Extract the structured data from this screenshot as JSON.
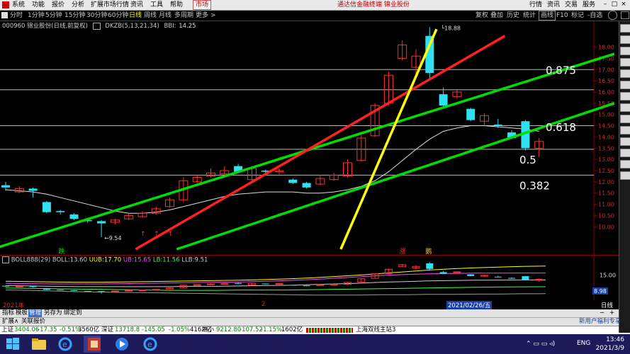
{
  "menu": {
    "items": [
      "系统",
      "功能",
      "报价",
      "分析",
      "扩展市场行情",
      "资讯",
      "工具",
      "帮助"
    ],
    "active": "市场",
    "center_title": "通达信金融终端  锦业股份",
    "right": [
      "行情",
      "资讯",
      "交易",
      "服务"
    ]
  },
  "periods": {
    "items": [
      "分时",
      "1分钟",
      "5分钟",
      "15分钟",
      "30分钟",
      "60分钟",
      "日线",
      "周线",
      "月线",
      "多周期",
      "更多 >"
    ],
    "selected_index": 6,
    "tools": [
      "复权",
      "叠加",
      "历史",
      "统计",
      "画线",
      "F10",
      "标记",
      "-自选"
    ]
  },
  "info": {
    "stock": "000960 锦业股份(日线,前复权)",
    "indicator": "DKZB(5,13,21,34)",
    "bbi_label": "BBI:",
    "bbi_value": "14.25"
  },
  "chart_data": {
    "type": "candlestick",
    "y_axis": {
      "min": 9,
      "max": 18.9,
      "ticks": [
        "18.00",
        "17.50",
        "17.00",
        "16.50",
        "16.00",
        "15.50",
        "15.00",
        "14.50",
        "14.00",
        "13.50",
        "13.00",
        "12.50",
        "12.00",
        "11.50",
        "11.00",
        "10.50",
        "10.00"
      ]
    },
    "candles": [
      {
        "o": 11.85,
        "c": 11.75,
        "h": 12.0,
        "l": 11.6
      },
      {
        "o": 11.55,
        "c": 11.7,
        "h": 11.8,
        "l": 11.5
      },
      {
        "o": 11.7,
        "c": 11.6,
        "h": 11.75,
        "l": 11.3
      },
      {
        "o": 11.1,
        "c": 10.65,
        "h": 11.15,
        "l": 10.6
      },
      {
        "o": 10.7,
        "c": 10.65,
        "h": 10.75,
        "l": 10.55
      },
      {
        "o": 10.55,
        "c": 10.35,
        "h": 10.6,
        "l": 10.3
      },
      {
        "o": 10.3,
        "c": 10.25,
        "h": 10.32,
        "l": 10.18
      },
      {
        "o": 10.25,
        "c": 10.15,
        "h": 10.3,
        "l": 9.54
      },
      {
        "o": 10.2,
        "c": 10.3,
        "h": 10.35,
        "l": 10.1
      },
      {
        "o": 10.35,
        "c": 10.5,
        "h": 10.6,
        "l": 10.3
      },
      {
        "o": 10.45,
        "c": 10.6,
        "h": 10.7,
        "l": 10.4
      },
      {
        "o": 10.6,
        "c": 10.8,
        "h": 10.9,
        "l": 10.55
      },
      {
        "o": 10.9,
        "c": 11.2,
        "h": 11.3,
        "l": 10.85
      },
      {
        "o": 11.2,
        "c": 12.05,
        "h": 12.2,
        "l": 11.1
      },
      {
        "o": 12.0,
        "c": 12.2,
        "h": 12.3,
        "l": 11.95
      },
      {
        "o": 12.25,
        "c": 12.4,
        "h": 12.6,
        "l": 12.2
      },
      {
        "o": 12.35,
        "c": 12.5,
        "h": 12.7,
        "l": 12.3
      },
      {
        "o": 12.7,
        "c": 12.45,
        "h": 12.8,
        "l": 12.4
      },
      {
        "o": 12.1,
        "c": 12.6,
        "h": 12.7,
        "l": 12.05
      },
      {
        "o": 12.5,
        "c": 12.45,
        "h": 12.55,
        "l": 12.35
      },
      {
        "o": 12.45,
        "c": 12.5,
        "h": 12.6,
        "l": 12.35
      },
      {
        "o": 12.1,
        "c": 11.95,
        "h": 12.15,
        "l": 11.9
      },
      {
        "o": 11.95,
        "c": 11.75,
        "h": 12.0,
        "l": 11.7
      },
      {
        "o": 11.9,
        "c": 12.15,
        "h": 12.3,
        "l": 11.85
      },
      {
        "o": 12.1,
        "c": 12.3,
        "h": 12.4,
        "l": 12.05
      },
      {
        "o": 12.25,
        "c": 12.85,
        "h": 13.0,
        "l": 12.2
      },
      {
        "o": 12.95,
        "c": 13.95,
        "h": 14.1,
        "l": 12.9
      },
      {
        "o": 14.05,
        "c": 15.4,
        "h": 15.5,
        "l": 14.0
      },
      {
        "o": 15.5,
        "c": 16.75,
        "h": 16.9,
        "l": 15.4
      },
      {
        "o": 17.5,
        "c": 18.1,
        "h": 18.3,
        "l": 17.4
      },
      {
        "o": 17.1,
        "c": 17.6,
        "h": 17.9,
        "l": 16.7
      },
      {
        "o": 18.5,
        "c": 16.85,
        "h": 18.88,
        "l": 16.6
      },
      {
        "o": 15.9,
        "c": 15.4,
        "h": 16.2,
        "l": 15.3
      },
      {
        "o": 15.8,
        "c": 16.0,
        "h": 16.1,
        "l": 15.7
      },
      {
        "o": 15.25,
        "c": 14.75,
        "h": 15.3,
        "l": 14.7
      },
      {
        "o": 14.7,
        "c": 14.95,
        "h": 15.05,
        "l": 14.5
      },
      {
        "o": 14.55,
        "c": 14.5,
        "h": 14.8,
        "l": 14.4
      },
      {
        "o": 14.2,
        "c": 13.95,
        "h": 14.3,
        "l": 13.9
      },
      {
        "o": 14.7,
        "c": 13.5,
        "h": 14.75,
        "l": 13.4
      },
      {
        "o": 13.5,
        "c": 13.8,
        "h": 13.95,
        "l": 13.1
      }
    ],
    "bbi_line": [
      11.65,
      11.6,
      11.55,
      11.45,
      11.3,
      11.15,
      11.0,
      10.85,
      10.7,
      10.6,
      10.6,
      10.65,
      10.75,
      10.9,
      11.05,
      11.2,
      11.35,
      11.45,
      11.5,
      11.55,
      11.55,
      11.55,
      11.5,
      11.5,
      11.55,
      11.65,
      11.8,
      12.05,
      12.45,
      12.95,
      13.45,
      13.9,
      14.25,
      14.4,
      14.5,
      14.5,
      14.45,
      14.4,
      14.35,
      14.25
    ],
    "h_levels": [
      17.0,
      16.1,
      14.5,
      13.45,
      12.3
    ],
    "level_labels": [
      {
        "text": "0.875",
        "level": 17.0
      },
      {
        "text": "0.618",
        "level": 14.45
      },
      {
        "text": "0.5",
        "level": 13.0
      },
      {
        "text": "0.382",
        "level": 11.85
      }
    ],
    "annotations": {
      "high": "18.88",
      "low": "9.54"
    },
    "markers": [
      "跌",
      "涨",
      "鹅"
    ],
    "trendlines": [
      {
        "color": "#00dd00",
        "from": [
          -1,
          9.0
        ],
        "to": [
          44.5,
          17.7
        ]
      },
      {
        "color": "#00dd00",
        "from": [
          12.5,
          9.0
        ],
        "to": [
          44.5,
          15.5
        ]
      },
      {
        "color": "#ff2020",
        "from": [
          9.5,
          9.0
        ],
        "to": [
          36.5,
          18.5
        ]
      },
      {
        "color": "#ffff00",
        "from": [
          24.5,
          9.0
        ],
        "to": [
          31.5,
          18.8
        ]
      }
    ]
  },
  "boll": {
    "title": "BOLL888(29)",
    "boll_label": "BOLL:",
    "boll_value": "13.60",
    "uub_label": "UUB:",
    "uub_value": "17.70",
    "ub_label": "UB:",
    "ub_value": "15.65",
    "lb_label": "LB:",
    "lb_value": "11.56",
    "llb_label": "LLB:",
    "llb_value": "9.51",
    "axis_tick": "15.00",
    "current_box": "8.98"
  },
  "xaxis": {
    "year": "2021年",
    "mid": "2",
    "date_box": "2021/02/26/五",
    "right_label": "日线"
  },
  "tabs": [
    "指标",
    "模板",
    "管理",
    "另存为",
    "绑定到"
  ],
  "tabs2": {
    "left": "扩展∧",
    "quote": "关联报价",
    "ad": "新用户福利专享"
  },
  "ticker": [
    {
      "label": "上证",
      "value": "3404.06",
      "change": "-17.35",
      "pct": "-0.51%",
      "vol": "3560亿"
    },
    {
      "label": "深证",
      "value": "13718.8",
      "change": "-145.05",
      "pct": "-1.05%",
      "vol": "4162亿"
    },
    {
      "label": "中小",
      "value": "9212.80",
      "change": "-107.52",
      "pct": "-1.15%",
      "vol": "1602亿"
    }
  ],
  "ticker_server": "上海双线主站3",
  "taskbar": {
    "lang": "ENG",
    "time": "13:46",
    "date": "2021/3/9"
  },
  "right_panel_icons": [
    "KDJ",
    "MACD",
    "BOLL",
    "RSI",
    "DMI",
    "VR",
    "CR",
    "OBV",
    "WR",
    "EXPMA",
    "ASI",
    "TRIX",
    "BIAS",
    "CCI"
  ]
}
